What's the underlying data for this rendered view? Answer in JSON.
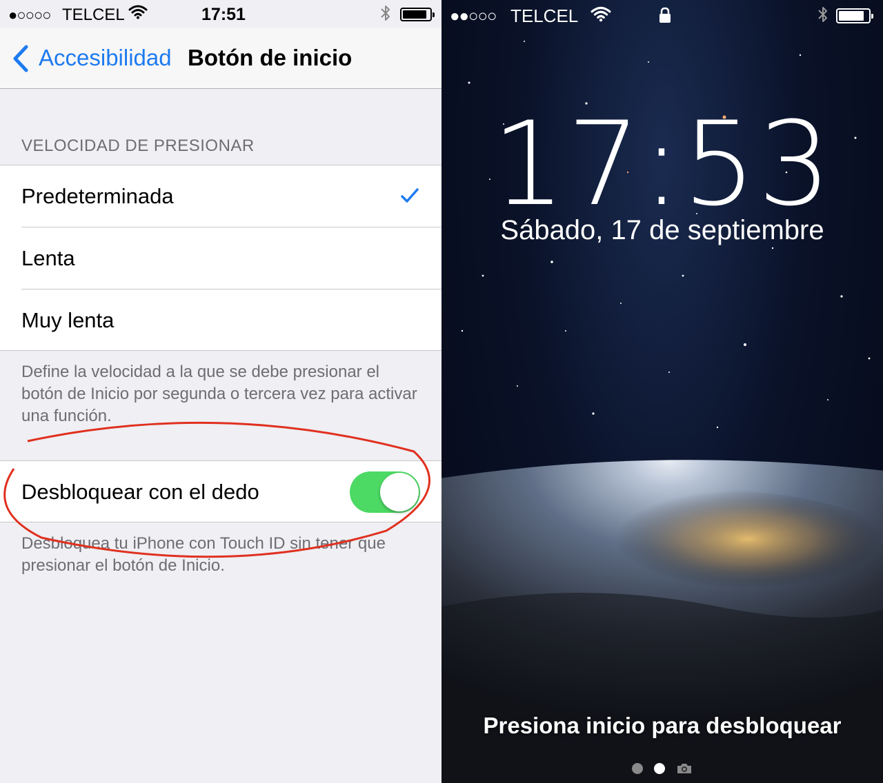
{
  "settings": {
    "status": {
      "signal": "●○○○○",
      "carrier": "TELCEL",
      "time": "17:51"
    },
    "nav": {
      "back_label": "Accesibilidad",
      "title": "Botón de inicio"
    },
    "section_header": "VELOCIDAD DE PRESIONAR",
    "options": [
      {
        "label": "Predeterminada",
        "selected": true
      },
      {
        "label": "Lenta",
        "selected": false
      },
      {
        "label": "Muy lenta",
        "selected": false
      }
    ],
    "speed_footer": "Define la velocidad a la que se debe presionar el botón de Inicio por segunda o tercera vez para activar una función.",
    "unlock_row": {
      "label": "Desbloquear con el dedo",
      "on": true
    },
    "unlock_footer": "Desbloquea tu iPhone con Touch ID sin tener que presionar el botón de Inicio.",
    "colors": {
      "accent": "#1e7bf0",
      "toggle_on": "#4cd964",
      "highlight": "#e0301e"
    }
  },
  "lockscreen": {
    "status": {
      "signal": "●●○○○",
      "carrier": "TELCEL"
    },
    "time": "17:53",
    "date": "Sábado, 17 de septiembre",
    "unlock_prompt": "Presiona inicio para desbloquear",
    "page_indicator": {
      "count": 2,
      "active": 1,
      "camera_icon": "camera-icon"
    }
  }
}
